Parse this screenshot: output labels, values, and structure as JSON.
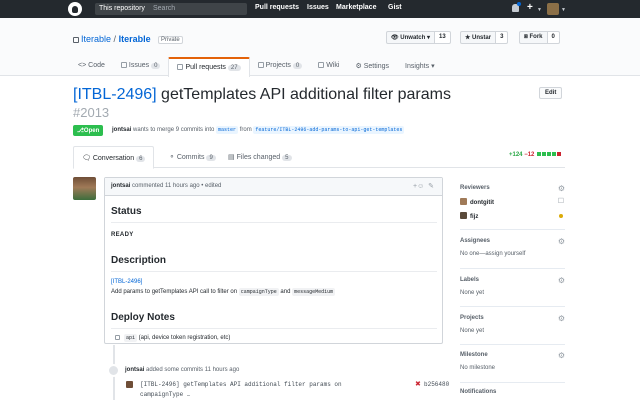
{
  "header": {
    "search_scope": "This repository",
    "search_placeholder": "Search",
    "nav": [
      "Pull requests",
      "Issues",
      "Marketplace",
      "Gist"
    ]
  },
  "repo": {
    "owner": "Iterable",
    "name": "Iterable",
    "visibility": "Private",
    "watch_label": "Unwatch",
    "watch_count": "13",
    "star_label": "Unstar",
    "star_count": "3",
    "fork_label": "Fork",
    "fork_count": "0",
    "tabs": [
      {
        "label": "Code",
        "count": ""
      },
      {
        "label": "Issues",
        "count": "0"
      },
      {
        "label": "Pull requests",
        "count": "27"
      },
      {
        "label": "Projects",
        "count": "0"
      },
      {
        "label": "Wiki",
        "count": ""
      },
      {
        "label": "Settings",
        "count": ""
      },
      {
        "label": "Insights",
        "count": ""
      }
    ]
  },
  "pr": {
    "ticket": "[ITBL-2496]",
    "title": " getTemplates API additional filter params",
    "number": "#2013",
    "edit_label": "Edit",
    "state": "Open",
    "author": "jontsai",
    "merge_text": " wants to merge 9 commits into ",
    "base_branch": "master",
    "from_text": " from ",
    "head_branch": "feature/ITBL-2496-add-params-to-api-get-templates",
    "tabs": [
      {
        "label": "Conversation",
        "count": "6"
      },
      {
        "label": "Commits",
        "count": "9"
      },
      {
        "label": "Files changed",
        "count": "5"
      }
    ],
    "additions": "+124",
    "deletions": "−12",
    "diffstat_colors": [
      "#2cbe4e",
      "#2cbe4e",
      "#2cbe4e",
      "#2cbe4e",
      "#cb2431"
    ]
  },
  "comment": {
    "author": "jontsai",
    "meta": " commented 11 hours ago • edited",
    "status_heading": "Status",
    "status_value": "READY",
    "description_heading": "Description",
    "ticket_link": "[ITBL-2496]",
    "desc_text_1": "Add params to getTemplates API call to filter on ",
    "code_1": "campaignType",
    "desc_and": " and ",
    "code_2": "messageMedium",
    "deploy_heading": "Deploy Notes",
    "task_code": "api",
    "task_text": " (api, device token registration, etc)"
  },
  "event": {
    "author": "jontsai",
    "text": " added some commits 11 hours ago",
    "commit_line1": "[ITBL-2496] getTemplates API additional filter params on",
    "commit_line2": "campaignType …",
    "commit_sha": "b256480"
  },
  "sidebar": {
    "reviewers_title": "Reviewers",
    "reviewers": [
      "dontgitit",
      "fijz"
    ],
    "assignees_title": "Assignees",
    "assignees_value": "No one—assign yourself",
    "labels_title": "Labels",
    "labels_value": "None yet",
    "projects_title": "Projects",
    "projects_value": "None yet",
    "milestone_title": "Milestone",
    "milestone_value": "No milestone",
    "notifications_title": "Notifications"
  }
}
